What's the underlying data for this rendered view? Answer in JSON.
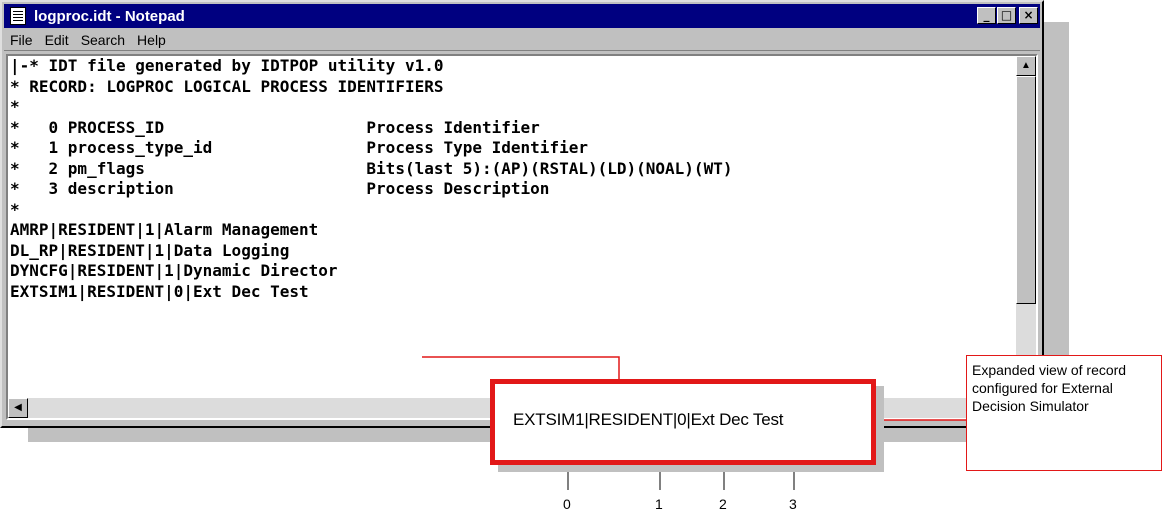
{
  "window": {
    "title": "logproc.idt - Notepad",
    "minimize_glyph": "_",
    "maximize_glyph": "□",
    "close_glyph": "×"
  },
  "menu": {
    "items": [
      "File",
      "Edit",
      "Search",
      "Help"
    ]
  },
  "editor": {
    "lines": [
      "|-* IDT file generated by IDTPOP utility v1.0",
      "* RECORD: LOGPROC LOGICAL PROCESS IDENTIFIERS",
      "*",
      "*   0 PROCESS_ID                     Process Identifier",
      "*   1 process_type_id                Process Type Identifier",
      "*   2 pm_flags                       Bits(last 5):(AP)(RSTAL)(LD)(NOAL)(WT)",
      "*   3 description                    Process Description",
      "*",
      "AMRP|RESIDENT|1|Alarm Management",
      "DL_RP|RESIDENT|1|Data Logging",
      "DYNCFG|RESIDENT|1|Dynamic Director",
      "EXTSIM1|RESIDENT|0|Ext Dec Test"
    ]
  },
  "callout": {
    "record_text": "EXTSIM1|RESIDENT|0|Ext Dec Test",
    "field_numbers": [
      "0",
      "1",
      "2",
      "3"
    ],
    "note": "Expanded view of record configured for External Decision Simulator"
  },
  "colors": {
    "title_bar": "#000080",
    "callout_border": "#e21818",
    "window_face": "#c0c0c0"
  }
}
